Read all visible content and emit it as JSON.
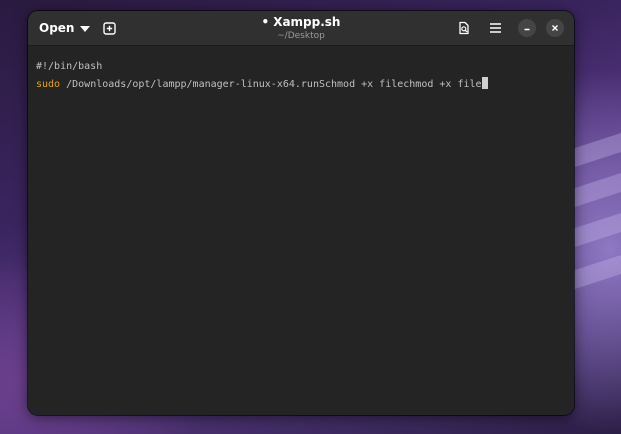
{
  "header": {
    "open_label": "Open",
    "title_dot": "•",
    "title": "Xampp.sh",
    "subtitle": "~/Desktop"
  },
  "editor": {
    "line1": "#!/bin/bash",
    "line2_keyword": "sudo",
    "line2_rest": " /Downloads/opt/lampp/manager-linux-x64.runSchmod +x filechmod +x file"
  },
  "icons": {
    "new_tab": "new-tab-icon",
    "document_search": "document-search-icon",
    "menu": "hamburger-menu-icon",
    "minimize": "minimize-icon",
    "close": "close-icon"
  },
  "colors": {
    "window_bg": "#242424",
    "headerbar_bg": "#303030",
    "keyword": "#e5a50a",
    "text": "#c0c0c0"
  }
}
